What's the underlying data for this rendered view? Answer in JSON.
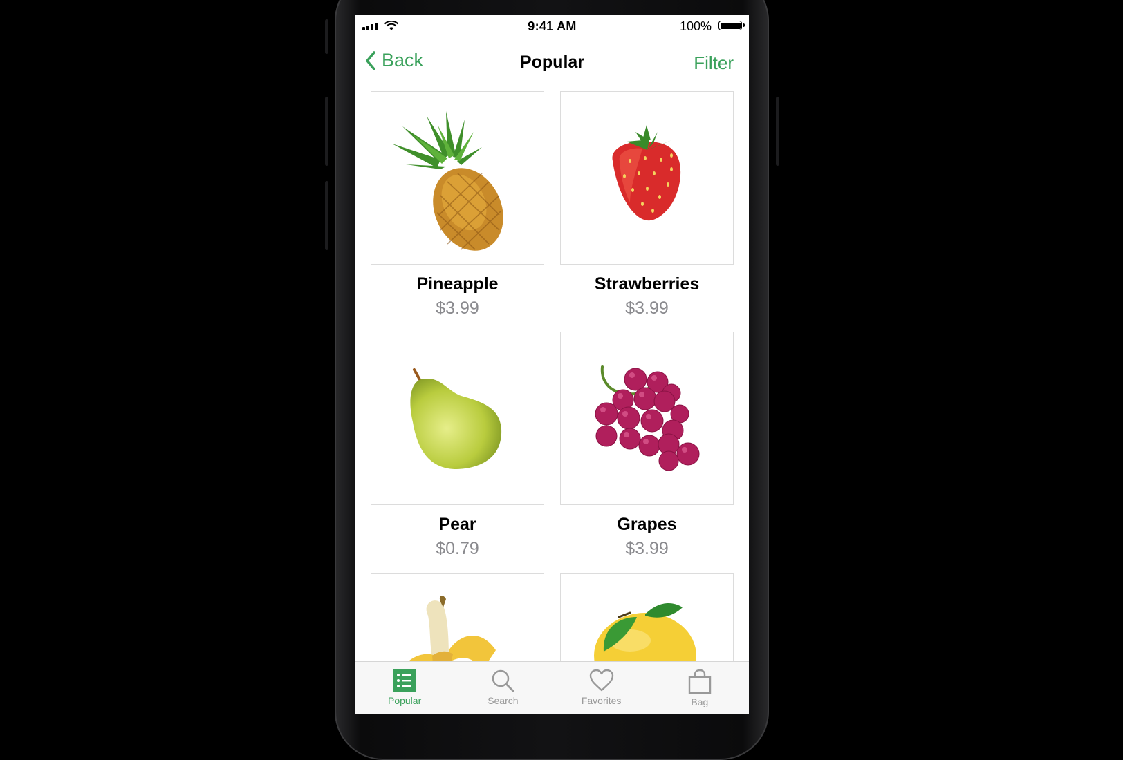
{
  "status_bar": {
    "time": "9:41 AM",
    "battery": "100%"
  },
  "nav": {
    "back_label": "Back",
    "title": "Popular",
    "filter_label": "Filter"
  },
  "products": [
    {
      "name": "Pineapple",
      "price": "$3.99",
      "icon": "pineapple-image"
    },
    {
      "name": "Strawberries",
      "price": "$3.99",
      "icon": "strawberry-image"
    },
    {
      "name": "Pear",
      "price": "$0.79",
      "icon": "pear-image"
    },
    {
      "name": "Grapes",
      "price": "$3.99",
      "icon": "grapes-image"
    },
    {
      "name": "",
      "price": "",
      "icon": "banana-image"
    },
    {
      "name": "",
      "price": "",
      "icon": "lemon-image"
    }
  ],
  "tabs": [
    {
      "label": "Popular",
      "icon": "list-icon",
      "active": true
    },
    {
      "label": "Search",
      "icon": "search-icon",
      "active": false
    },
    {
      "label": "Favorites",
      "icon": "heart-icon",
      "active": false
    },
    {
      "label": "Bag",
      "icon": "bag-icon",
      "active": false
    }
  ],
  "colors": {
    "accent": "#3aa15b",
    "price": "#8a8a8e"
  }
}
